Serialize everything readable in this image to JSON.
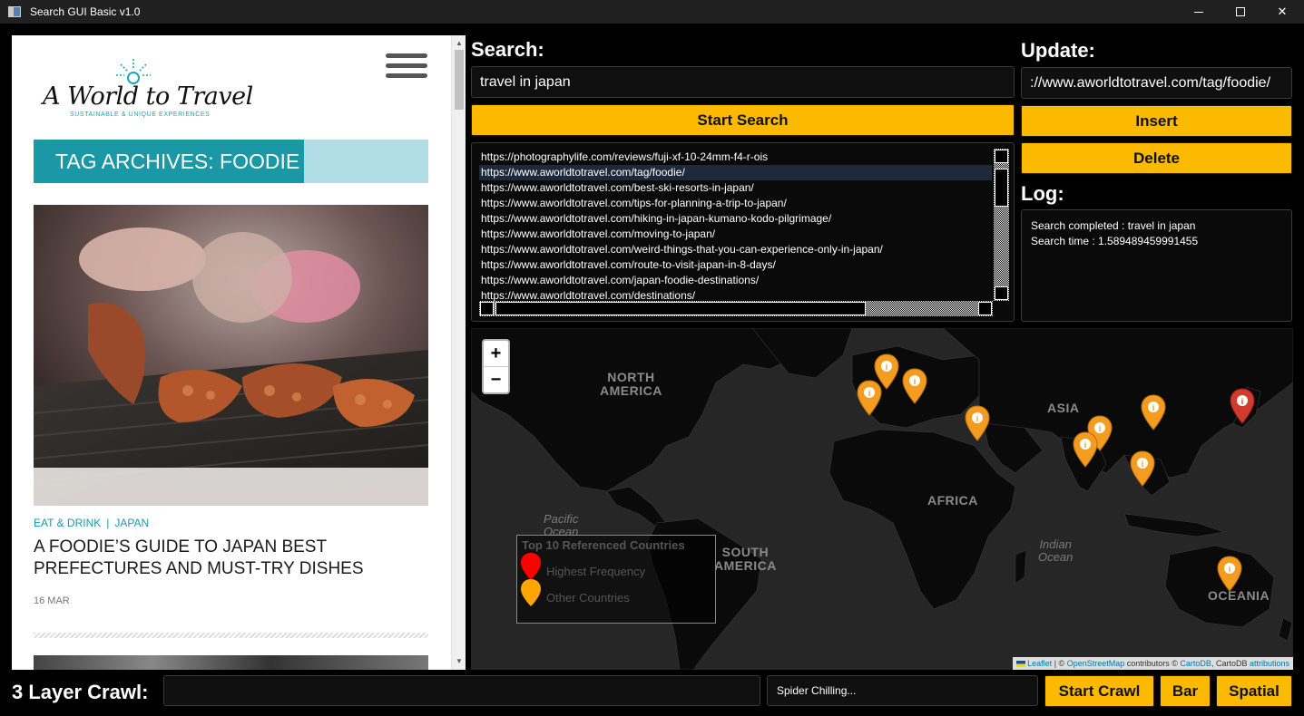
{
  "window": {
    "title": "Search GUI Basic v1.0",
    "minimize_label": "—",
    "close_label": "✕"
  },
  "browser": {
    "logo_text": "A World to Travel",
    "logo_tagline": "SUSTAINABLE & UNIQUE EXPERIENCES",
    "tag_heading": "TAG ARCHIVES: FOODIE",
    "post_category_1": "EAT & DRINK",
    "post_category_sep": "|",
    "post_category_2": "JAPAN",
    "post_title": "A FOODIE’S GUIDE TO JAPAN BEST PREFECTURES AND MUST-TRY DISHES",
    "post_date": "16 MAR"
  },
  "search": {
    "label": "Search:",
    "query": "travel in japan",
    "button_label": "Start Search"
  },
  "update": {
    "label": "Update:",
    "value": "://www.aworldtotravel.com/tag/foodie/",
    "insert_label": "Insert",
    "delete_label": "Delete"
  },
  "results": {
    "selected_index": 1,
    "items": [
      "https://photographylife.com/reviews/fuji-xf-10-24mm-f4-r-ois",
      "https://www.aworldtotravel.com/tag/foodie/",
      "https://www.aworldtotravel.com/best-ski-resorts-in-japan/",
      "https://www.aworldtotravel.com/tips-for-planning-a-trip-to-japan/",
      "https://www.aworldtotravel.com/hiking-in-japan-kumano-kodo-pilgrimage/",
      "https://www.aworldtotravel.com/moving-to-japan/",
      "https://www.aworldtotravel.com/weird-things-that-you-can-experience-only-in-japan/",
      "https://www.aworldtotravel.com/route-to-visit-japan-in-8-days/",
      "https://www.aworldtotravel.com/japan-foodie-destinations/",
      "https://www.aworldtotravel.com/destinations/"
    ]
  },
  "log": {
    "label": "Log:",
    "lines": [
      "Search completed : travel in japan",
      "Search time : 1.589489459991455"
    ]
  },
  "map": {
    "zoom_in": "+",
    "zoom_out": "−",
    "regions": {
      "north_america_1": "NORTH",
      "north_america_2": "AMERICA",
      "south_america_1": "SOUTH",
      "south_america_2": "AMERICA",
      "asia": "ASIA",
      "africa": "AFRICA",
      "oceania": "OCEANIA",
      "pacific_1": "Pacific",
      "pacific_2": "Ocean",
      "indian_1": "Indian",
      "indian_2": "Ocean"
    },
    "legend": {
      "title": "Top 10 Referenced Countries",
      "highest": "Highest Frequency",
      "other": "Other Countries"
    },
    "attribution": {
      "leaflet": "Leaflet",
      "sep": "| ©",
      "osm": "OpenStreetMap",
      "contributors": "contributors ©",
      "cartodb": "CartoDB",
      "cartodb_text": ", CartoDB",
      "attributions": "attributions"
    },
    "highest_color": "#d23a2e",
    "other_color": "#f39c1f"
  },
  "crawl": {
    "label": "3 Layer Crawl:",
    "input_value": "",
    "status": "Spider Chilling...",
    "start_label": "Start Crawl",
    "bar_label": "Bar",
    "spatial_label": "Spatial"
  }
}
